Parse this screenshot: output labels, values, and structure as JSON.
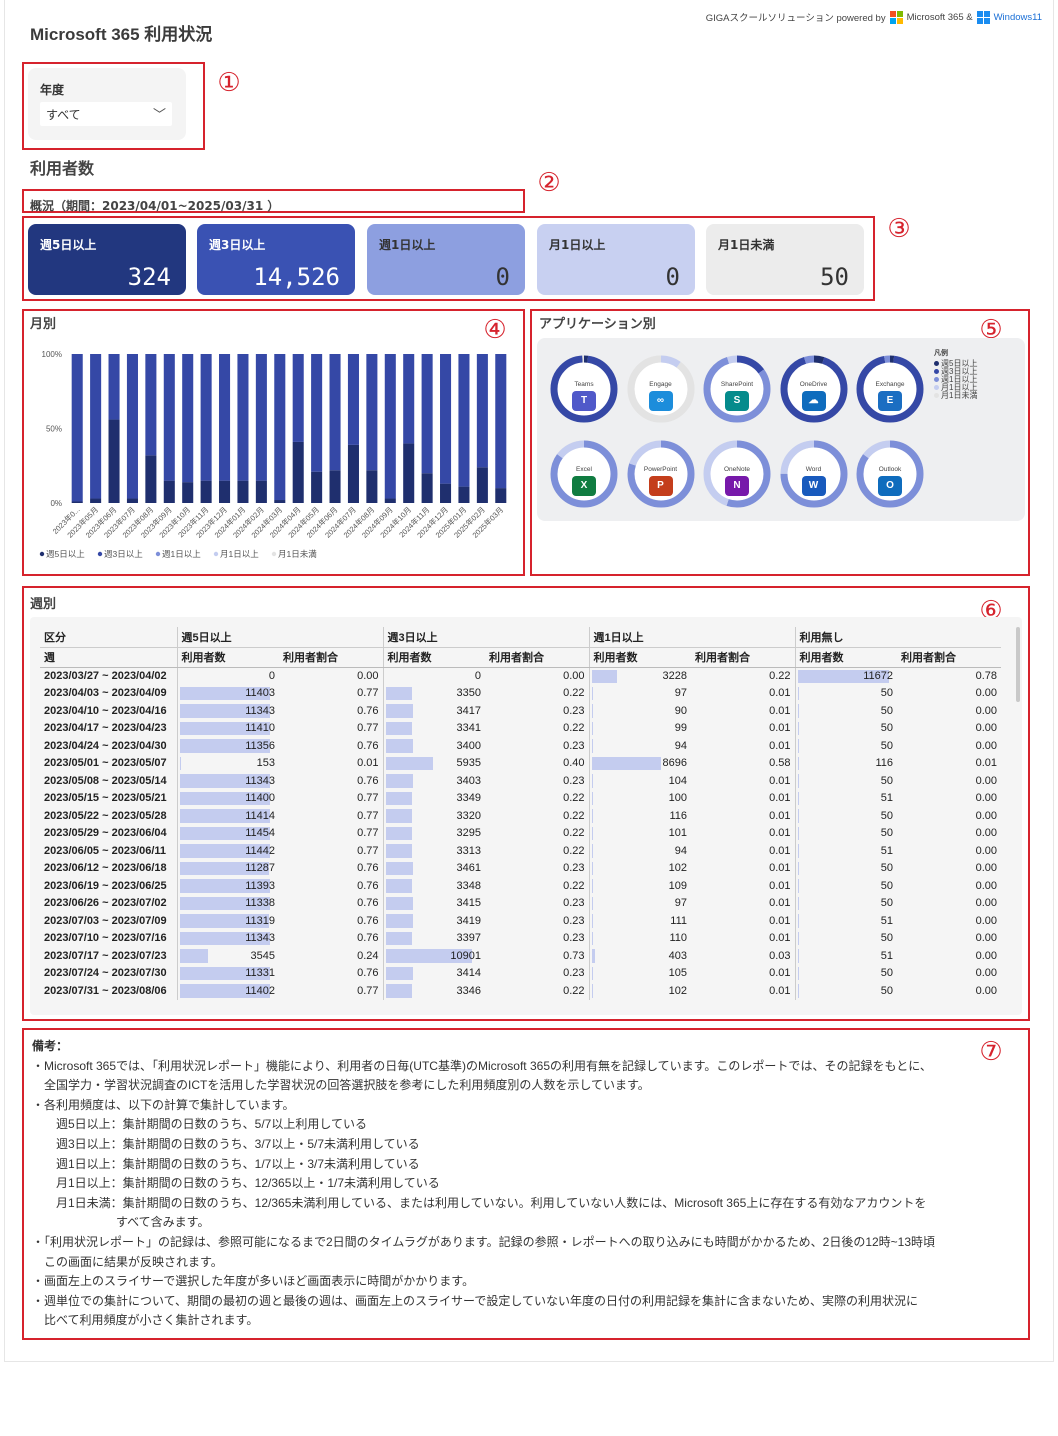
{
  "header": {
    "title": "Microsoft 365 利用状況",
    "brand_prefix": "GIGAスクールソリューション  powered by",
    "brand_ms": "Microsoft 365 &",
    "brand_win": "Windows11"
  },
  "markers": [
    "①",
    "②",
    "③",
    "④",
    "⑤",
    "⑥",
    "⑦"
  ],
  "slicer": {
    "label": "年度",
    "value": "すべて"
  },
  "section_users": "利用者数",
  "period_label": "概況（期間：2023/04/01~2025/03/31 ）",
  "kpis": [
    {
      "label": "週5日以上",
      "value": "324",
      "color": "#22377f",
      "text": "#ffffff"
    },
    {
      "label": "週3日以上",
      "value": "14,526",
      "color": "#3a52b3",
      "text": "#ffffff"
    },
    {
      "label": "週1日以上",
      "value": "0",
      "color": "#8d9fe0",
      "text": "#333333"
    },
    {
      "label": "月1日以上",
      "value": "0",
      "color": "#c8d0f1",
      "text": "#333333"
    },
    {
      "label": "月1日未満",
      "value": "50",
      "color": "#ececec",
      "text": "#333333"
    }
  ],
  "monthly": {
    "title": "月別"
  },
  "chart_data": {
    "type": "bar",
    "stacked": true,
    "categories": [
      "2023年0...",
      "2023年05月",
      "2023年06月",
      "2023年07月",
      "2023年08月",
      "2023年09月",
      "2023年10月",
      "2023年11月",
      "2023年12月",
      "2024年01月",
      "2024年02月",
      "2024年03月",
      "2024年04月",
      "2024年05月",
      "2024年06月",
      "2024年07月",
      "2024年08月",
      "2024年09月",
      "2024年10月",
      "2024年11月",
      "2024年12月",
      "2025年01月",
      "2025年02月",
      "2025年03月"
    ],
    "series": [
      {
        "name": "週5日以上",
        "color": "#1f2f6e",
        "values": [
          0.01,
          0.03,
          0.56,
          0.03,
          0.32,
          0.15,
          0.14,
          0.15,
          0.15,
          0.15,
          0.15,
          0.02,
          0.41,
          0.21,
          0.22,
          0.39,
          0.22,
          0.03,
          0.4,
          0.2,
          0.13,
          0.11,
          0.24,
          0.1
        ]
      },
      {
        "name": "週3日以上",
        "color": "#3548a6",
        "values": [
          0.99,
          0.97,
          0.44,
          0.97,
          0.68,
          0.85,
          0.86,
          0.85,
          0.85,
          0.85,
          0.85,
          0.98,
          0.59,
          0.79,
          0.78,
          0.61,
          0.78,
          0.97,
          0.6,
          0.8,
          0.87,
          0.89,
          0.76,
          0.9
        ]
      },
      {
        "name": "週1日以上",
        "color": "#7d8fd9",
        "values": [
          0,
          0,
          0,
          0,
          0,
          0,
          0,
          0,
          0,
          0,
          0,
          0,
          0,
          0,
          0,
          0,
          0,
          0,
          0,
          0,
          0,
          0,
          0,
          0
        ]
      },
      {
        "name": "月1日以上",
        "color": "#c4cdf0",
        "values": [
          0,
          0,
          0,
          0,
          0,
          0,
          0,
          0,
          0,
          0,
          0,
          0,
          0,
          0,
          0,
          0,
          0,
          0,
          0,
          0,
          0,
          0,
          0,
          0
        ]
      },
      {
        "name": "月1日未満",
        "color": "#e3e3e3",
        "values": [
          0,
          0,
          0,
          0,
          0,
          0,
          0,
          0,
          0,
          0,
          0,
          0,
          0,
          0,
          0,
          0,
          0,
          0,
          0,
          0,
          0,
          0,
          0,
          0
        ]
      }
    ],
    "yticks": [
      "100%",
      "50%",
      "0%"
    ],
    "ylim": [
      0,
      1
    ],
    "legend": "bottom",
    "grid": false
  },
  "apps": {
    "title": "アプリケーション別",
    "legend_title": "凡例",
    "legend": [
      {
        "label": "週5日以上",
        "color": "#1f2f6e"
      },
      {
        "label": "週3日以上",
        "color": "#3548a6"
      },
      {
        "label": "週1日以上",
        "color": "#7d8fd9"
      },
      {
        "label": "月1日以上",
        "color": "#c4cdf0"
      },
      {
        "label": "月1日未満",
        "color": "#e3e3e3"
      }
    ],
    "items": [
      {
        "name": "Teams",
        "icon": "teams-icon",
        "letter": "T",
        "logo": "#5059c9",
        "share": [
          0.02,
          0.97,
          0,
          0,
          0.01
        ]
      },
      {
        "name": "Engage",
        "icon": "engage-icon",
        "letter": "∞",
        "logo": "#1c8ddb",
        "share": [
          0,
          0,
          0,
          0.1,
          0.9
        ]
      },
      {
        "name": "SharePoint",
        "icon": "sharepoint-icon",
        "letter": "S",
        "logo": "#058b8c",
        "share": [
          0,
          0.15,
          0.8,
          0.05,
          0
        ]
      },
      {
        "name": "OneDrive",
        "icon": "onedrive-icon",
        "letter": "☁",
        "logo": "#0f6cbd",
        "share": [
          0.05,
          0.9,
          0.05,
          0,
          0
        ]
      },
      {
        "name": "Exchange",
        "icon": "exchange-icon",
        "letter": "E",
        "logo": "#1b6ec2",
        "share": [
          0.02,
          0.95,
          0.03,
          0,
          0
        ]
      },
      {
        "name": "Excel",
        "icon": "excel-icon",
        "letter": "X",
        "logo": "#107c41",
        "share": [
          0,
          0,
          0.85,
          0.15,
          0
        ]
      },
      {
        "name": "PowerPoint",
        "icon": "powerpoint-icon",
        "letter": "P",
        "logo": "#c43e1c",
        "share": [
          0,
          0,
          0.8,
          0.2,
          0
        ]
      },
      {
        "name": "OneNote",
        "icon": "onenote-icon",
        "letter": "N",
        "logo": "#7719aa",
        "share": [
          0,
          0,
          0.55,
          0.45,
          0
        ]
      },
      {
        "name": "Word",
        "icon": "word-icon",
        "letter": "W",
        "logo": "#185abd",
        "share": [
          0,
          0,
          0.75,
          0.25,
          0
        ]
      },
      {
        "name": "Outlook",
        "icon": "outlook-icon",
        "letter": "O",
        "logo": "#0f6cbd",
        "share": [
          0,
          0,
          0.85,
          0.15,
          0
        ]
      }
    ]
  },
  "weekly": {
    "title": "週別",
    "header_kubun": "区分",
    "header_week": "週",
    "groups": [
      "週5日以上",
      "週3日以上",
      "週1日以上",
      "利用無し"
    ],
    "sub_count": "利用者数",
    "sub_ratio": "利用者割合",
    "rows": [
      {
        "w": "2023/03/27 ~ 2023/04/02",
        "v": [
          "0",
          "0.00",
          "0",
          "0.00",
          "3228",
          "0.22",
          "11672",
          "0.78"
        ]
      },
      {
        "w": "2023/04/03 ~ 2023/04/09",
        "v": [
          "11403",
          "0.77",
          "3350",
          "0.22",
          "97",
          "0.01",
          "50",
          "0.00"
        ]
      },
      {
        "w": "2023/04/10 ~ 2023/04/16",
        "v": [
          "11343",
          "0.76",
          "3417",
          "0.23",
          "90",
          "0.01",
          "50",
          "0.00"
        ]
      },
      {
        "w": "2023/04/17 ~ 2023/04/23",
        "v": [
          "11410",
          "0.77",
          "3341",
          "0.22",
          "99",
          "0.01",
          "50",
          "0.00"
        ]
      },
      {
        "w": "2023/04/24 ~ 2023/04/30",
        "v": [
          "11356",
          "0.76",
          "3400",
          "0.23",
          "94",
          "0.01",
          "50",
          "0.00"
        ]
      },
      {
        "w": "2023/05/01 ~ 2023/05/07",
        "v": [
          "153",
          "0.01",
          "5935",
          "0.40",
          "8696",
          "0.58",
          "116",
          "0.01"
        ]
      },
      {
        "w": "2023/05/08 ~ 2023/05/14",
        "v": [
          "11343",
          "0.76",
          "3403",
          "0.23",
          "104",
          "0.01",
          "50",
          "0.00"
        ]
      },
      {
        "w": "2023/05/15 ~ 2023/05/21",
        "v": [
          "11400",
          "0.77",
          "3349",
          "0.22",
          "100",
          "0.01",
          "51",
          "0.00"
        ]
      },
      {
        "w": "2023/05/22 ~ 2023/05/28",
        "v": [
          "11414",
          "0.77",
          "3320",
          "0.22",
          "116",
          "0.01",
          "50",
          "0.00"
        ]
      },
      {
        "w": "2023/05/29 ~ 2023/06/04",
        "v": [
          "11454",
          "0.77",
          "3295",
          "0.22",
          "101",
          "0.01",
          "50",
          "0.00"
        ]
      },
      {
        "w": "2023/06/05 ~ 2023/06/11",
        "v": [
          "11442",
          "0.77",
          "3313",
          "0.22",
          "94",
          "0.01",
          "51",
          "0.00"
        ]
      },
      {
        "w": "2023/06/12 ~ 2023/06/18",
        "v": [
          "11287",
          "0.76",
          "3461",
          "0.23",
          "102",
          "0.01",
          "50",
          "0.00"
        ]
      },
      {
        "w": "2023/06/19 ~ 2023/06/25",
        "v": [
          "11393",
          "0.76",
          "3348",
          "0.22",
          "109",
          "0.01",
          "50",
          "0.00"
        ]
      },
      {
        "w": "2023/06/26 ~ 2023/07/02",
        "v": [
          "11338",
          "0.76",
          "3415",
          "0.23",
          "97",
          "0.01",
          "50",
          "0.00"
        ]
      },
      {
        "w": "2023/07/03 ~ 2023/07/09",
        "v": [
          "11319",
          "0.76",
          "3419",
          "0.23",
          "111",
          "0.01",
          "51",
          "0.00"
        ]
      },
      {
        "w": "2023/07/10 ~ 2023/07/16",
        "v": [
          "11343",
          "0.76",
          "3397",
          "0.23",
          "110",
          "0.01",
          "50",
          "0.00"
        ]
      },
      {
        "w": "2023/07/17 ~ 2023/07/23",
        "v": [
          "3545",
          "0.24",
          "10901",
          "0.73",
          "403",
          "0.03",
          "51",
          "0.00"
        ]
      },
      {
        "w": "2023/07/24 ~ 2023/07/30",
        "v": [
          "11331",
          "0.76",
          "3414",
          "0.23",
          "105",
          "0.01",
          "50",
          "0.00"
        ]
      },
      {
        "w": "2023/07/31 ~ 2023/08/06",
        "v": [
          "11402",
          "0.77",
          "3346",
          "0.22",
          "102",
          "0.01",
          "50",
          "0.00"
        ]
      }
    ]
  },
  "notes": [
    "備考：",
    "・Microsoft 365では、「利用状況レポート」機能により、利用者の日毎(UTC基準)のMicrosoft 365の利用有無を記録しています。このレポートでは、その記録をもとに、",
    "　全国学力・学習状況調査のICTを活用した学習状況の回答選択肢を参考にした利用頻度別の人数を示しています。",
    "・各利用頻度は、以下の計算で集計しています。",
    "　　週5日以上：集計期間の日数のうち、5/7以上利用している",
    "　　週3日以上：集計期間の日数のうち、3/7以上・5/7未満利用している",
    "　　週1日以上：集計期間の日数のうち、1/7以上・3/7未満利用している",
    "　　月1日以上：集計期間の日数のうち、12/365以上・1/7未満利用している",
    "　　月1日未満：集計期間の日数のうち、12/365未満利用している、または利用していない。利用していない人数には、Microsoft 365上に存在する有効なアカウントを",
    "　　　　　　　すべて含みます。",
    "・「利用状況レポート」の記録は、参照可能になるまで2日間のタイムラグがあります。記録の参照・レポートへの取り込みにも時間がかかるため、2日後の12時~13時頃",
    "　この画面に結果が反映されます。",
    "・画面左上のスライサーで選択した年度が多いほど画面表示に時間がかかります。",
    "・週単位での集計について、期間の最初の週と最後の週は、画面左上のスライサーで設定していない年度の日付の利用記録を集計に含まないため、実際の利用状況に",
    "　比べて利用頻度が小さく集計されます。"
  ]
}
